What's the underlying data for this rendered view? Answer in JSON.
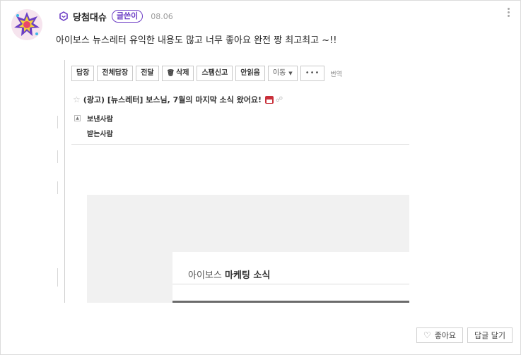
{
  "comment": {
    "author": "당첨대슈",
    "badge": "글쓴이",
    "date": "08.06",
    "text": "아이보스 뉴스레터 유익한 내용도 많고 너무 좋아요 완전 짱 최고최고 ~!!",
    "grade_icon": "grade-diamond-icon",
    "accent_color": "#6d3ec5"
  },
  "screenshot": {
    "toolbar": {
      "reply": "답장",
      "reply_all": "전체답장",
      "forward": "전달",
      "delete": "삭제",
      "spam": "스팸신고",
      "unread": "안읽음",
      "move": "이동",
      "more": "•••",
      "translate": "번역"
    },
    "subject": "(광고) [뉴스레터] 보스님, 7월의 마지막 소식 왔어요!",
    "sender_label": "보낸사람",
    "receiver_label": "받는사람",
    "newsletter_title_light": "아이보스 ",
    "newsletter_title_bold": "마케팅 소식"
  },
  "actions": {
    "like": "좋아요",
    "reply": "답글 달기"
  }
}
